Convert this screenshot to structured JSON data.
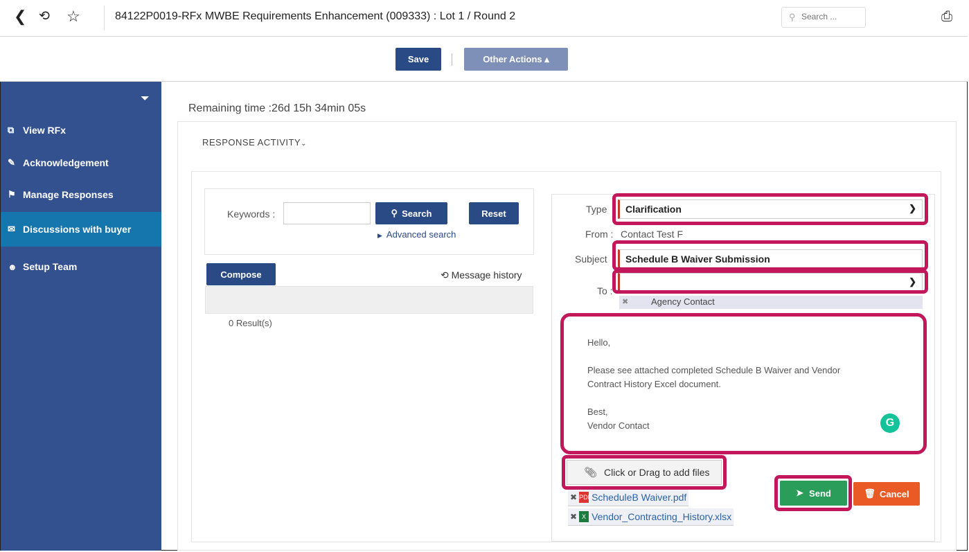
{
  "header": {
    "title": "84122P0019-RFx MWBE Requirements Enhancement (009333) : Lot 1 / Round 2",
    "search_placeholder": "Search ..."
  },
  "toolbar": {
    "save_label": "Save",
    "other_actions_label": "Other Actions ▴"
  },
  "sidebar": {
    "items": [
      {
        "label": "View RFx",
        "icon": "document-icon"
      },
      {
        "label": "Acknowledgement",
        "icon": "edit-icon"
      },
      {
        "label": "Manage Responses",
        "icon": "tag-icon"
      },
      {
        "label": "Discussions with buyer",
        "icon": "chat-icon",
        "active": true
      },
      {
        "label": "Setup Team",
        "icon": "team-icon"
      }
    ]
  },
  "main": {
    "remaining_time": "Remaining time :26d 15h 34min 05s",
    "section_label": "RESPONSE ACTIVITY",
    "search": {
      "keywords_label": "Keywords :",
      "keywords_value": "",
      "search_label": "Search",
      "reset_label": "Reset",
      "advanced_label": "Advanced search"
    },
    "compose_label": "Compose",
    "message_history_label": "Message history",
    "results_label": "0 Result(s)"
  },
  "message_form": {
    "type_label": "Type",
    "type_value": "Clarification",
    "from_label": "From :",
    "from_value": "Contact Test F",
    "subject_label": "Subject",
    "subject_value": "Schedule B Waiver Submission",
    "to_label": "To :",
    "to_value": "",
    "recipient": "Agency Contact",
    "body": {
      "greeting": "Hello,",
      "line1": "Please see attached completed Schedule B Waiver and Vendor",
      "line2": "Contract History Excel document.",
      "closing": "Best,",
      "signature": "Vendor Contact"
    },
    "attach_label": "Click or Drag to add files",
    "attachments": [
      {
        "name": "ScheduleB Waiver.pdf",
        "type": "pdf"
      },
      {
        "name": "Vendor_Contracting_History.xlsx",
        "type": "xlsx"
      }
    ],
    "send_label": "Send",
    "cancel_label": "Cancel"
  },
  "colors": {
    "primary": "#2a4a85",
    "sidebar": "#33518f",
    "sidebar_active": "#1476ad",
    "send": "#2a9d5a",
    "cancel": "#ea5a24",
    "highlight": "#c2185b"
  }
}
